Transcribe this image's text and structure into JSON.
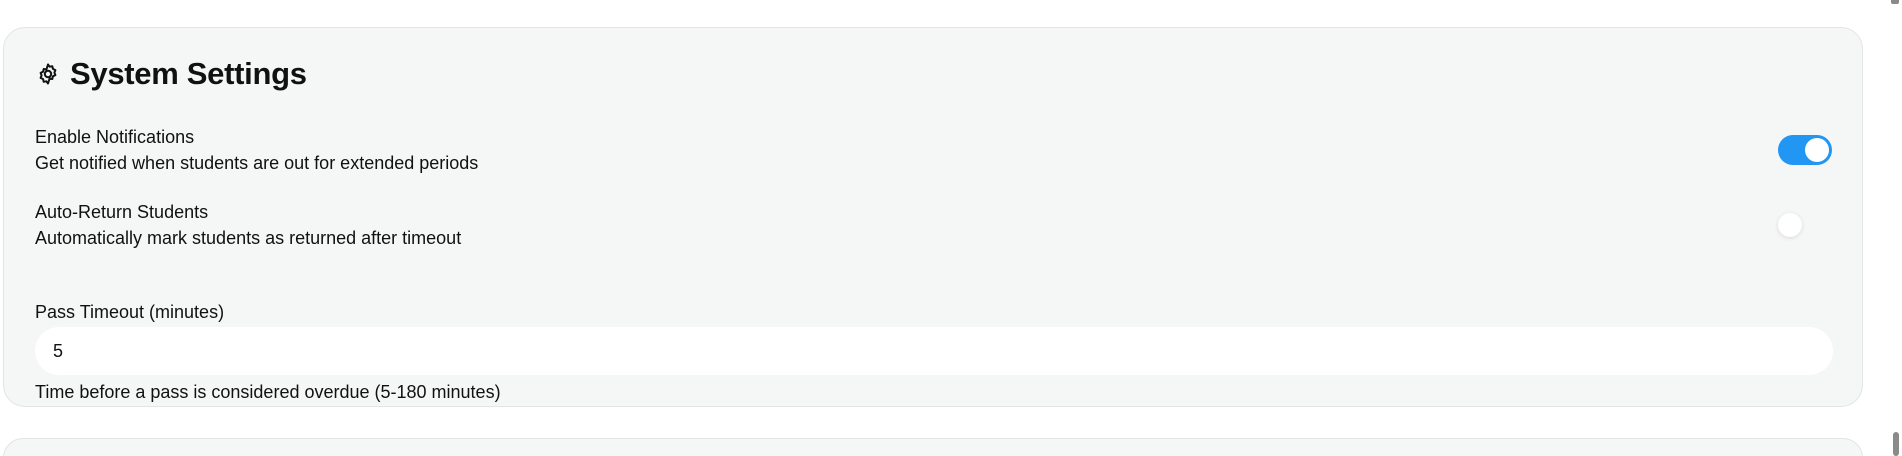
{
  "settings_card": {
    "title": "System Settings",
    "icon": "gear-icon",
    "notifications": {
      "label": "Enable Notifications",
      "description": "Get notified when students are out for extended periods",
      "enabled": true
    },
    "auto_return": {
      "label": "Auto-Return Students",
      "description": "Automatically mark students as returned after timeout",
      "enabled": false
    },
    "pass_timeout": {
      "label": "Pass Timeout (minutes)",
      "value": "5",
      "help": "Time before a pass is considered overdue (5-180 minutes)"
    }
  },
  "colors": {
    "accent": "#2196f3",
    "card_background": "#f5f6f6"
  }
}
